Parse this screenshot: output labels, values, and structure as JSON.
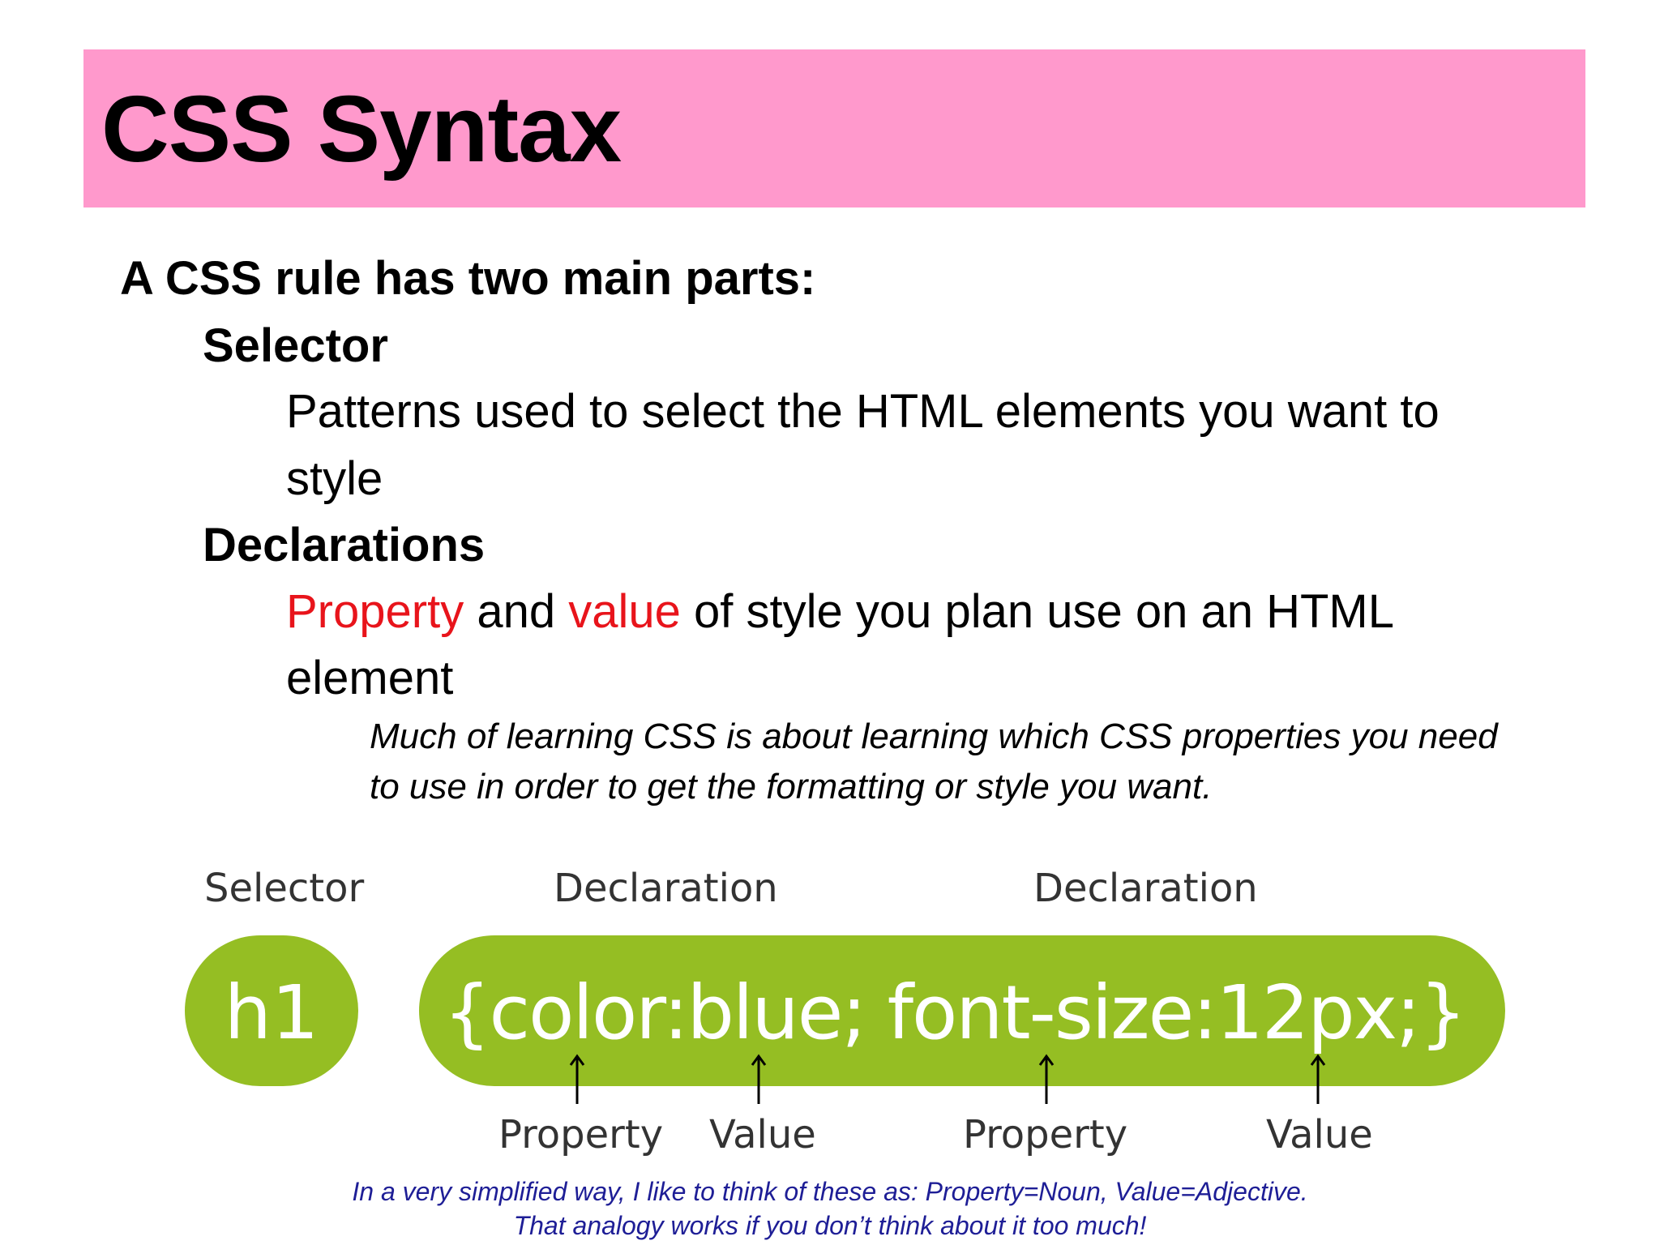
{
  "slide": {
    "title": "CSS Syntax",
    "intro": "A CSS rule has two main parts:",
    "selector_heading": "Selector",
    "selector_desc_line1": "Patterns used to select the HTML elements you want to",
    "selector_desc_line2": "style",
    "declarations_heading": "Declarations",
    "declarations_desc": {
      "property_word": "Property",
      "and_word": " and ",
      "value_word": "value",
      "rest": " of style you plan use on an HTML",
      "line2": "element"
    },
    "note_line1": "Much of learning CSS is about learning which CSS properties you need",
    "note_line2": "to use in order to get the formatting or style you want."
  },
  "diagram": {
    "selector_label": "Selector",
    "declaration_label_1": "Declaration",
    "declaration_label_2": "Declaration",
    "selector_code": "h1",
    "declaration_code": "{color:blue; font-size:12px;}",
    "property_label_1": "Property",
    "value_label_1": "Value",
    "property_label_2": "Property",
    "value_label_2": "Value",
    "accent_color": "#95be23"
  },
  "caption": {
    "line1": "In a very simplified way, I like to think of these as: Property=Noun, Value=Adjective.",
    "line2": "That analogy works if you don’t think about it too much!"
  },
  "colors": {
    "title_bar": "#ff99cc",
    "highlight_red": "#e8141b",
    "caption_blue": "#1e1e96"
  }
}
